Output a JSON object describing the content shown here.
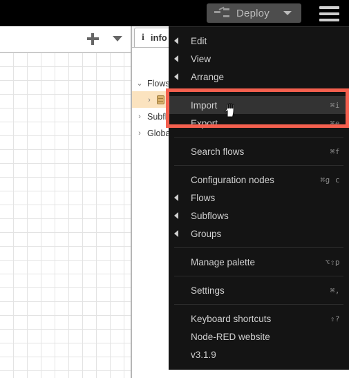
{
  "header": {
    "deploy": {
      "label": "Deploy",
      "icon": "deploy-icon",
      "caret_icon": "chevron-down-icon",
      "disabled_color": "#4d4d4d"
    },
    "main_menu_icon": "hamburger-menu-icon",
    "background": "#000000"
  },
  "workspace": {
    "add_tab_icon": "plus-icon",
    "tab_list_icon": "chevron-down-icon",
    "grid_color": "#e3e3e3"
  },
  "sidebar": {
    "tab": {
      "icon_glyph": "i",
      "icon_name": "info-icon",
      "label": "info"
    },
    "tree": [
      {
        "twisty": "⌄",
        "label": "Flows",
        "expanded": true,
        "selected": false,
        "child": false,
        "chip": false
      },
      {
        "twisty": "›",
        "label": "",
        "expanded": false,
        "selected": true,
        "child": true,
        "chip": true
      },
      {
        "twisty": "›",
        "label": "Subflows",
        "expanded": false,
        "selected": false,
        "child": false,
        "chip": false
      },
      {
        "twisty": "›",
        "label": "Global",
        "expanded": false,
        "selected": false,
        "child": false,
        "chip": false
      }
    ],
    "selected_row_color": "#fbe3bf"
  },
  "menu": {
    "background": "#141414",
    "hover_background": "#333333",
    "items": [
      {
        "label": "Edit",
        "shortcut": "",
        "submenu": true,
        "hovered": false,
        "sep_after": false
      },
      {
        "label": "View",
        "shortcut": "",
        "submenu": true,
        "hovered": false,
        "sep_after": false
      },
      {
        "label": "Arrange",
        "shortcut": "",
        "submenu": true,
        "hovered": false,
        "sep_after": true
      },
      {
        "label": "Import",
        "shortcut": "⌘i",
        "submenu": false,
        "hovered": true,
        "sep_after": false
      },
      {
        "label": "Export",
        "shortcut": "⌘e",
        "submenu": false,
        "hovered": false,
        "sep_after": true
      },
      {
        "label": "Search flows",
        "shortcut": "⌘f",
        "submenu": false,
        "hovered": false,
        "sep_after": true
      },
      {
        "label": "Configuration nodes",
        "shortcut": "⌘g c",
        "submenu": false,
        "hovered": false,
        "sep_after": false
      },
      {
        "label": "Flows",
        "shortcut": "",
        "submenu": true,
        "hovered": false,
        "sep_after": false
      },
      {
        "label": "Subflows",
        "shortcut": "",
        "submenu": true,
        "hovered": false,
        "sep_after": false
      },
      {
        "label": "Groups",
        "shortcut": "",
        "submenu": true,
        "hovered": false,
        "sep_after": true
      },
      {
        "label": "Manage palette",
        "shortcut": "⌥⇧p",
        "submenu": false,
        "hovered": false,
        "sep_after": true
      },
      {
        "label": "Settings",
        "shortcut": "⌘,",
        "submenu": false,
        "hovered": false,
        "sep_after": true
      },
      {
        "label": "Keyboard shortcuts",
        "shortcut": "⇧?",
        "submenu": false,
        "hovered": false,
        "sep_after": false
      },
      {
        "label": "Node-RED website",
        "shortcut": "",
        "submenu": false,
        "hovered": false,
        "sep_after": false
      },
      {
        "label": "v3.1.9",
        "shortcut": "",
        "submenu": false,
        "hovered": false,
        "sep_after": false
      }
    ]
  },
  "annotation": {
    "name": "import-highlight-box",
    "color": "#f4604f"
  },
  "cursor": {
    "name": "pointing-hand-cursor"
  }
}
